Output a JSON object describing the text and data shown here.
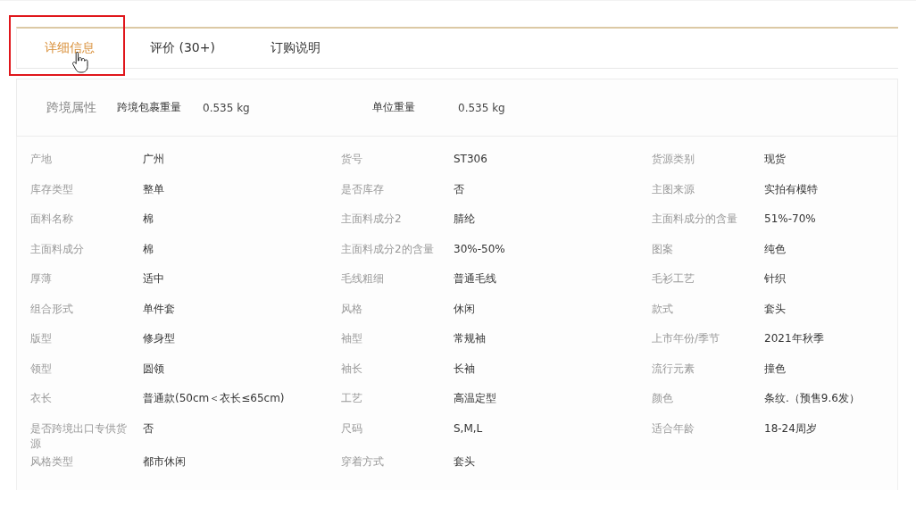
{
  "tabs": [
    {
      "label": "详细信息",
      "selected": true
    },
    {
      "label": "评价 (30+)",
      "selected": false
    },
    {
      "label": "订购说明",
      "selected": false
    }
  ],
  "cross_border": {
    "title": "跨境属性",
    "fields": [
      {
        "label": "跨境包裹重量",
        "value": "0.535 kg"
      },
      {
        "label": "单位重量",
        "value": "0.535 kg"
      }
    ]
  },
  "attributes": [
    {
      "label": "产地",
      "value": "广州"
    },
    {
      "label": "货号",
      "value": "ST306"
    },
    {
      "label": "货源类别",
      "value": "现货"
    },
    {
      "label": "库存类型",
      "value": "整单"
    },
    {
      "label": "是否库存",
      "value": "否"
    },
    {
      "label": "主图来源",
      "value": "实拍有模特"
    },
    {
      "label": "面料名称",
      "value": "棉"
    },
    {
      "label": "主面料成分2",
      "value": "腈纶"
    },
    {
      "label": "主面料成分的含量",
      "value": "51%-70%"
    },
    {
      "label": "主面料成分",
      "value": "棉"
    },
    {
      "label": "主面料成分2的含量",
      "value": "30%-50%"
    },
    {
      "label": "图案",
      "value": "纯色"
    },
    {
      "label": "厚薄",
      "value": "适中"
    },
    {
      "label": "毛线粗细",
      "value": "普通毛线"
    },
    {
      "label": "毛衫工艺",
      "value": "针织"
    },
    {
      "label": "组合形式",
      "value": "单件套"
    },
    {
      "label": "风格",
      "value": "休闲"
    },
    {
      "label": "款式",
      "value": "套头"
    },
    {
      "label": "版型",
      "value": "修身型"
    },
    {
      "label": "袖型",
      "value": "常规袖"
    },
    {
      "label": "上市年份/季节",
      "value": "2021年秋季"
    },
    {
      "label": "领型",
      "value": "圆领"
    },
    {
      "label": "袖长",
      "value": "长袖"
    },
    {
      "label": "流行元素",
      "value": "撞色"
    },
    {
      "label": "衣长",
      "value": "普通款(50cm＜衣长≤65cm)"
    },
    {
      "label": "工艺",
      "value": "高温定型"
    },
    {
      "label": "颜色",
      "value": "条纹.（预售9.6发）"
    },
    {
      "label": "是否跨境出口专供货源",
      "value": "否"
    },
    {
      "label": "尺码",
      "value": "S,M,L"
    },
    {
      "label": "适合年龄",
      "value": "18-24周岁"
    },
    {
      "label": "风格类型",
      "value": "都市休闲"
    },
    {
      "label": "穿着方式",
      "value": "套头"
    }
  ]
}
